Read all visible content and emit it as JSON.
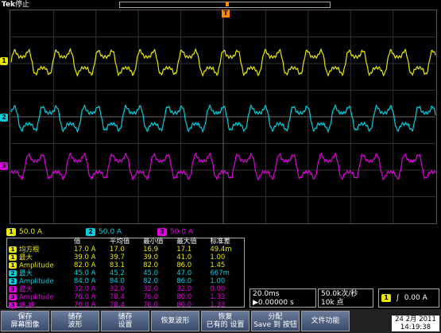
{
  "topbar": {
    "brand": "Tek",
    "status": "停止"
  },
  "channels": [
    {
      "id": "1",
      "color": "#e8e800",
      "scale": "50.0 A"
    },
    {
      "id": "2",
      "color": "#00d0e0",
      "scale": "50.0 A"
    },
    {
      "id": "3",
      "color": "#e000e0",
      "scale": "50.0 A"
    }
  ],
  "trigger_marker": "T",
  "measurements": {
    "headers": [
      "",
      "值",
      "平均值",
      "最小值",
      "最大值",
      "标准差"
    ],
    "rows": [
      {
        "ch": "1",
        "name": "均方根",
        "value": "17.0 A",
        "mean": "17.0",
        "min": "16.9",
        "max": "17.1",
        "std": "49.4m"
      },
      {
        "ch": "1",
        "name": "最大",
        "value": "39.0 A",
        "mean": "39.7",
        "min": "39.0",
        "max": "41.0",
        "std": "1.00"
      },
      {
        "ch": "1",
        "name": "Amplitude",
        "value": "82.0 A",
        "mean": "83.1",
        "min": "82.0",
        "max": "86.0",
        "std": "1.45"
      },
      {
        "ch": "2",
        "name": "最大",
        "value": "45.0 A",
        "mean": "45.2",
        "min": "45.0",
        "max": "47.0",
        "std": "667m"
      },
      {
        "ch": "2",
        "name": "Amplitude",
        "value": "84.0 A",
        "mean": "84.0",
        "min": "82.0",
        "max": "86.0",
        "std": "1.00"
      },
      {
        "ch": "3",
        "name": "最大",
        "value": "32.0 A",
        "mean": "32.0",
        "min": "32.0",
        "max": "32.0",
        "std": "0.00"
      },
      {
        "ch": "3",
        "name": "Amplitude",
        "value": "76.0 A",
        "mean": "78.4",
        "min": "76.0",
        "max": "80.0",
        "std": "1.33"
      },
      {
        "ch": "3",
        "name": "峰-峰",
        "value": "76.0 A",
        "mean": "78.4",
        "min": "76.0",
        "max": "80.0",
        "std": "1.33"
      }
    ]
  },
  "timebase": {
    "scale": "20.0ms",
    "delay": "▶0.00000 s"
  },
  "acquisition": {
    "rate": "50.0k次/秒",
    "points": "10k 点"
  },
  "trigger": {
    "source": "1",
    "slope": "∫",
    "level": "0.00 A"
  },
  "softkeys": [
    {
      "line1": "保存",
      "line2": "屏幕图像"
    },
    {
      "line1": "储存",
      "line2": "波形"
    },
    {
      "line1": "储存",
      "line2": "设置"
    },
    {
      "line1": "恢复波形",
      "line2": ""
    },
    {
      "line1": "恢复",
      "line2": "已有的 设置"
    },
    {
      "line1": "分配",
      "line2": "Save 到 按钮"
    },
    {
      "line1": "文件功能",
      "line2": ""
    }
  ],
  "datetime": {
    "date": "24 2月 2011",
    "time": "14:19:38"
  }
}
